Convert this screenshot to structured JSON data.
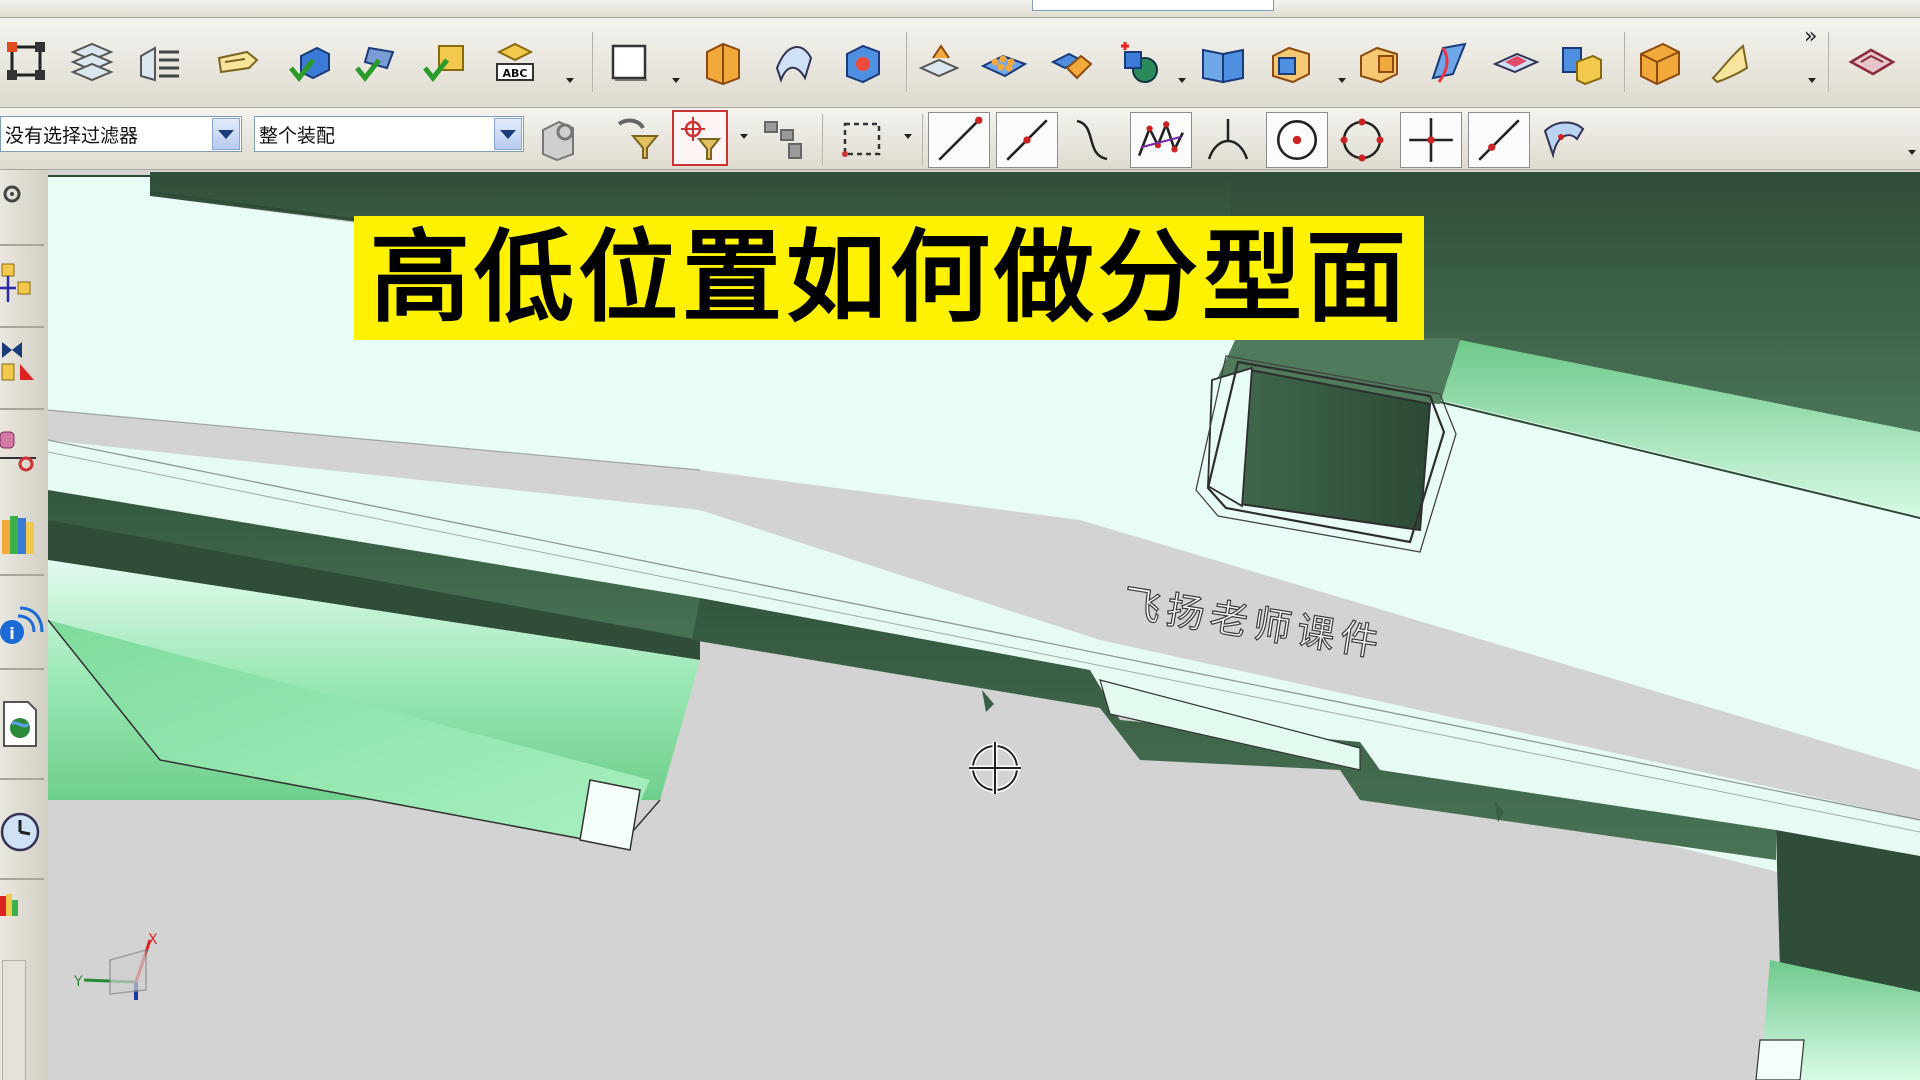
{
  "app": {
    "name": "3D CAD modeling application",
    "video_title": "高低位置如何做分型面",
    "watermark": "飞扬老师课件"
  },
  "selection_bar": {
    "type_filter": {
      "value": "没有选择过滤器",
      "options": [
        "没有选择过滤器"
      ]
    },
    "scope": {
      "value": "整个装配",
      "options": [
        "整个装配"
      ]
    }
  },
  "toolbar_row1": {
    "icons": [
      "make-datum-icon",
      "layer-settings-icon",
      "layer-list-icon",
      "message-tag-icon",
      "check-body-icon",
      "check-geometry-icon",
      "check-face-icon",
      "annotation-abc-icon",
      "sketch-plane-icon",
      "bounding-block-icon",
      "revolve-surface-icon",
      "box-block-icon",
      "extract-face-icon",
      "pattern-feature-icon",
      "boolean-unite-icon",
      "insert-primitive-icon",
      "book-view-icon",
      "block-feature-icon",
      "block-feature-2-icon",
      "sweep-surface-icon",
      "offset-face-icon",
      "combine-body-icon",
      "solid-block-icon",
      "bounded-plane-icon",
      "patch-surface-icon"
    ]
  },
  "toolbar_row2": {
    "icons": [
      "selection-intent-icon",
      "filter-funnel-icon",
      "snap-point-filter-icon",
      "assembly-group-icon",
      "rectangle-select-icon"
    ],
    "snap_points": [
      "endpoint-icon",
      "midpoint-icon",
      "control-point-icon",
      "intersection-icon",
      "tangent-icon",
      "arc-center-icon",
      "quadrant-icon",
      "existing-point-icon",
      "point-on-curve-icon",
      "point-on-face-icon"
    ]
  },
  "left_bar": {
    "icons": [
      "settings-icon",
      "assembly-navigator-icon",
      "constraint-navigator-icon",
      "part-navigator-icon",
      "reuse-library-icon",
      "hd3d-tools-icon",
      "web-browser-icon",
      "history-icon",
      "palette-icon"
    ]
  },
  "axis_triad": {
    "x_label": "X",
    "y_label": "Y"
  },
  "colors": {
    "yellow_banner": "#fff200",
    "model_face_light": "#e6fdf6",
    "model_face_green": "#9fefb9",
    "model_face_dark": "#3d5f47",
    "background": "#d3d3d3"
  }
}
